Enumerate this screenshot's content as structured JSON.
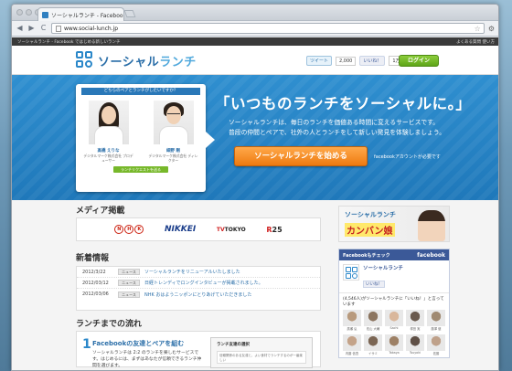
{
  "browser": {
    "tab_title": "ソーシャルランチ - Facebook",
    "tab_close": "×",
    "url": "www.social-lunch.jp",
    "back": "◀",
    "forward": "▶",
    "reload": "C",
    "star": "☆",
    "wrench": "⚙"
  },
  "strip": {
    "left": "ソーシャルランチ - Facebook ではじめる新しいランチ",
    "right": "よくある質問 使い方"
  },
  "header": {
    "logo_main": "ソーシャル",
    "logo_accent": "ランチ",
    "tweet_label": "ツイート",
    "tweet_count": "2,000",
    "like_label": "いいね！",
    "like_count": "1万",
    "login_label": "ログイン"
  },
  "hero": {
    "card_header": "どちらのペアとランチがしたいですか？",
    "person1_name": "高橋 えりな",
    "person1_role": "デジタルマーケ株式会社 プロデューサー",
    "person2_name": "細野 剛",
    "person2_role": "デジタルマーケ株式会社 ディレクター",
    "card_button": "ランチリクエストを送る",
    "title": "「いつものランチをソーシャルに。」",
    "desc_line1": "ソーシャルランチは、毎日のランチを価値ある時間に変えるサービスです。",
    "desc_line2": "普段の仲間とペアで、社外の人とランチをして新しい発見を体験しましょう。",
    "cta": "ソーシャルランチを始める",
    "cta_note": "facebookアカウントが必要です"
  },
  "media": {
    "title": "メディア掲載",
    "nhk": [
      "N",
      "H",
      "K"
    ],
    "nikkei": "NIKKEI",
    "tvtokyo_a": "TV",
    "tvtokyo_b": "TOKYO",
    "r25_a": "R",
    "r25_b": "25"
  },
  "news": {
    "title": "新着情報",
    "items": [
      {
        "date": "2012/3/22",
        "tag": "ニュース",
        "text": "ソーシャルランチをリニューアルいたしました"
      },
      {
        "date": "2012/03/12",
        "tag": "ニュース",
        "text": "日経トレンディでロングインタビューが掲載されました。"
      },
      {
        "date": "2012/03/06",
        "tag": "ニュース",
        "text": "NHK おはようニッポンにとりあげていただきました"
      }
    ]
  },
  "flow": {
    "title": "ランチまでの流れ",
    "step_num": "1",
    "step_title": "Facebookの友達とペアを組む",
    "step_desc": "ソーシャルランチは 2:2 のランチを楽しむサービスです。はじめるには、まずはあなたが信頼できるランチ仲間を選びます。",
    "shot_title": "ランチ友達の選択",
    "shot_body": "信頼関係のある友達と、よい食材でランチするのが一番楽しい"
  },
  "banner": {
    "line1": "ソーシャルランチ",
    "line2": "カンバン娘"
  },
  "fb": {
    "header": "Facebookもチェック",
    "brand": "facebook",
    "page_name": "ソーシャルランチ",
    "like": "いいね！",
    "count": "(4,546人)がソーシャルランチに「いいね！」と言っています",
    "faces": [
      {
        "name": "廣瀬 弘",
        "color": "#b89a7d"
      },
      {
        "name": "佐山 大輔",
        "color": "#8c7560"
      },
      {
        "name": "Sachi",
        "color": "#d9b79c"
      },
      {
        "name": "塚田 実",
        "color": "#6a5a4e"
      },
      {
        "name": "藤澤 健",
        "color": "#a08a72"
      },
      {
        "name": "内藤 信吾",
        "color": "#c4a389"
      },
      {
        "name": "イサミ",
        "color": "#7b6654"
      },
      {
        "name": "Takaya",
        "color": "#9d8065"
      },
      {
        "name": "Tsuyoki",
        "color": "#5f5046"
      },
      {
        "name": "佐藤",
        "color": "#bfa18a"
      }
    ]
  }
}
